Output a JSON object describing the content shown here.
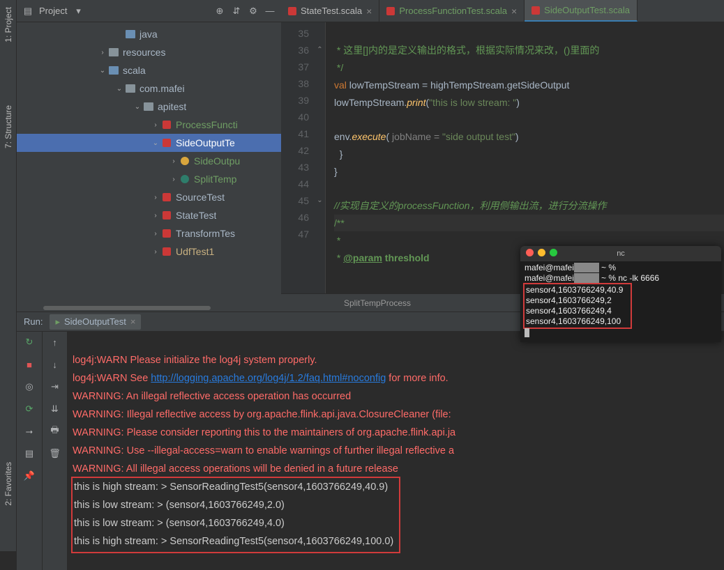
{
  "sidebar": {
    "project": "1: Project",
    "structure": "7: Structure",
    "favorites": "2: Favorites"
  },
  "project": {
    "title": "Project",
    "tree": {
      "java": "java",
      "resources": "resources",
      "scala": "scala",
      "com_mafei": "com.mafei",
      "apitest": "apitest",
      "processFuncti": "ProcessFuncti",
      "sideOutputTe": "SideOutputTe",
      "sideOutpu": "SideOutpu",
      "splitTemp": "SplitTemp",
      "sourceTest": "SourceTest",
      "stateTest": "StateTest",
      "transformTes": "TransformTes",
      "udfTest1": "UdfTest1"
    }
  },
  "tabs": {
    "state": "StateTest.scala",
    "process": "ProcessFunctionTest.scala",
    "side": "SideOutputTest.scala"
  },
  "gutter": [
    "35",
    "36",
    "37",
    "38",
    "39",
    "40",
    "41",
    "42",
    "43",
    "44",
    "45",
    "46",
    "47"
  ],
  "code": {
    "l35": " * 这里[]内的是定义输出的格式，根据实际情况来改，()里面的",
    "l36": " */",
    "l37_kw": "val",
    "l37_rest": " lowTempStream = highTempStream.getSideOutput",
    "l38a": "lowTempStream.",
    "l38b": "print",
    "l38c": "(",
    "l38d": "\"this is low stream: \"",
    "l38e": ")",
    "l40a": "env.",
    "l40b": "execute",
    "l40c": "(",
    "l40d": " jobName = ",
    "l40e": "\"side output test\"",
    "l40f": ")",
    "l41": "  }",
    "l42": "}",
    "l44": "//实现自定义的processFunction，利用侧输出流，进行分流操作",
    "l45": "/**",
    "l46": " *",
    "l47a": " * ",
    "l47b": "@param",
    "l47c": " threshold"
  },
  "crumb": "SplitTempProcess",
  "terminal": {
    "title": "nc",
    "line1a": "mafei@mafei",
    "line1b": " ~ %",
    "line2a": "mafei@mafei",
    "line2b": " ~ % nc -lk 6666",
    "l3": "sensor4,1603766249,40.9",
    "l4": "sensor4,1603766249,2",
    "l5": "sensor4,1603766249,4",
    "l6": "sensor4,1603766249,100"
  },
  "run": {
    "label": "Run:",
    "tab": "SideOutputTest",
    "l1": "log4j:WARN Please initialize the log4j system properly.",
    "l2a": "log4j:WARN See ",
    "l2b": "http://logging.apache.org/log4j/1.2/faq.html#noconfig",
    "l2c": " for more info.",
    "l3": "WARNING: An illegal reflective access operation has occurred",
    "l4": "WARNING: Illegal reflective access by org.apache.flink.api.java.ClosureCleaner (file:",
    "l5": "WARNING: Please consider reporting this to the maintainers of org.apache.flink.api.ja",
    "l6": "WARNING: Use --illegal-access=warn to enable warnings of further illegal reflective a",
    "l7": "WARNING: All illegal access operations will be denied in a future release",
    "o1": "this is high stream: > SensorReadingTest5(sensor4,1603766249,40.9)",
    "o2": "this is low stream: > (sensor4,1603766249,2.0)",
    "o3": "this is low stream: > (sensor4,1603766249,4.0)",
    "o4": "this is high stream: > SensorReadingTest5(sensor4,1603766249,100.0)"
  }
}
